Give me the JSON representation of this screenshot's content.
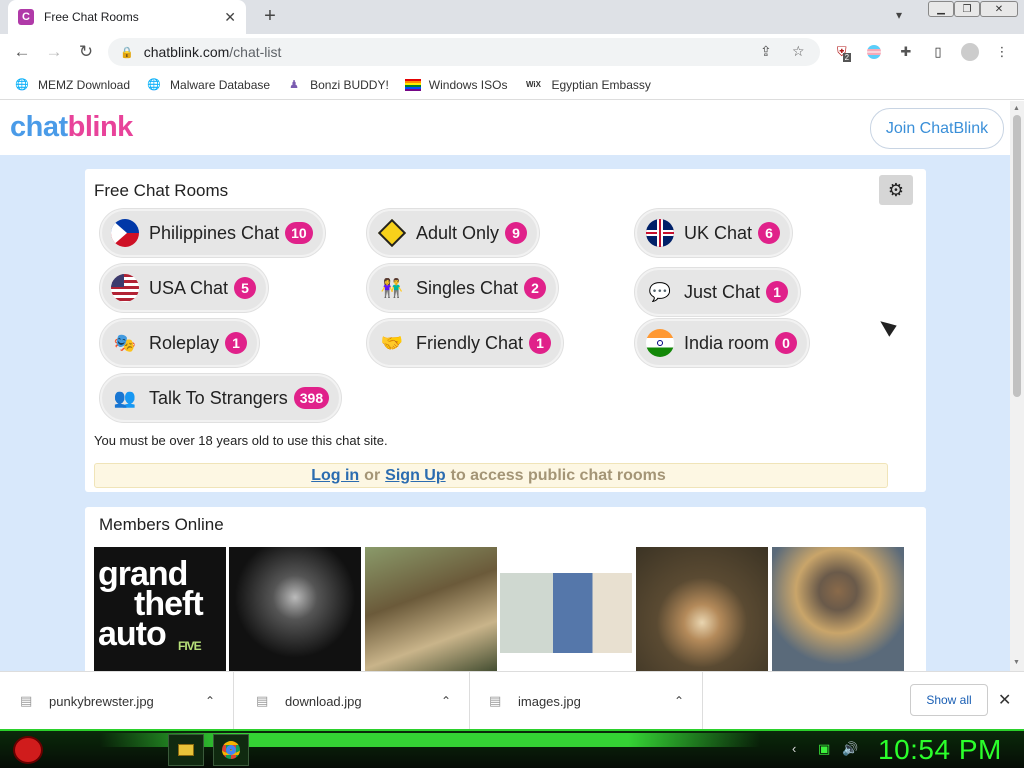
{
  "browser": {
    "tab_title": "Free Chat Rooms",
    "tab_favicon": "C",
    "url_host": "chatblink.com",
    "url_path": "/chat-list",
    "extension_badge": "2"
  },
  "bookmarks": [
    {
      "label": "MEMZ Download",
      "icon": "globe-icon"
    },
    {
      "label": "Malware Database",
      "icon": "globe-icon"
    },
    {
      "label": "Bonzi BUDDY!",
      "icon": "bonzi-icon"
    },
    {
      "label": "Windows ISOs",
      "icon": "rainbow-flag-icon"
    },
    {
      "label": "Egyptian Embassy",
      "icon": "wix-icon"
    }
  ],
  "site": {
    "logo_part1": "chat",
    "logo_part2": "blink",
    "join_label": "Join ChatBlink",
    "brand_blue": "#4a9be8",
    "brand_pink": "#e8439a"
  },
  "rooms_panel": {
    "title": "Free Chat Rooms",
    "rooms": [
      {
        "name": "Philippines Chat",
        "count": "10",
        "icon": "philippines-flag-icon"
      },
      {
        "name": "Adult Only",
        "count": "9",
        "icon": "adult-sign-icon"
      },
      {
        "name": "UK Chat",
        "count": "6",
        "icon": "uk-flag-icon"
      },
      {
        "name": "USA Chat",
        "count": "5",
        "icon": "usa-flag-icon"
      },
      {
        "name": "Singles Chat",
        "count": "2",
        "icon": "singles-icon"
      },
      {
        "name": "Just Chat",
        "count": "1",
        "icon": "speech-bubbles-icon"
      },
      {
        "name": "Roleplay",
        "count": "1",
        "icon": "mask-icon"
      },
      {
        "name": "Friendly Chat",
        "count": "1",
        "icon": "handshake-icon"
      },
      {
        "name": "India room",
        "count": "0",
        "icon": "india-flag-icon"
      },
      {
        "name": "Talk To Strangers",
        "count": "398",
        "icon": "users-lock-icon"
      }
    ],
    "age_notice": "You must be over 18 years old to use this chat site.",
    "login_text": "Log in",
    "or_text": "or",
    "signup_text": "Sign Up",
    "access_text": "to access public chat rooms"
  },
  "members": {
    "title": "Members Online",
    "gta_line1": "grand",
    "gta_line2": "theft",
    "gta_line3": "auto",
    "gta_five": "FIVE"
  },
  "downloads": {
    "files": [
      "punkybrewster.jpg",
      "download.jpg",
      "images.jpg"
    ],
    "show_all": "Show all"
  },
  "taskbar": {
    "clock": "10:54 PM"
  }
}
